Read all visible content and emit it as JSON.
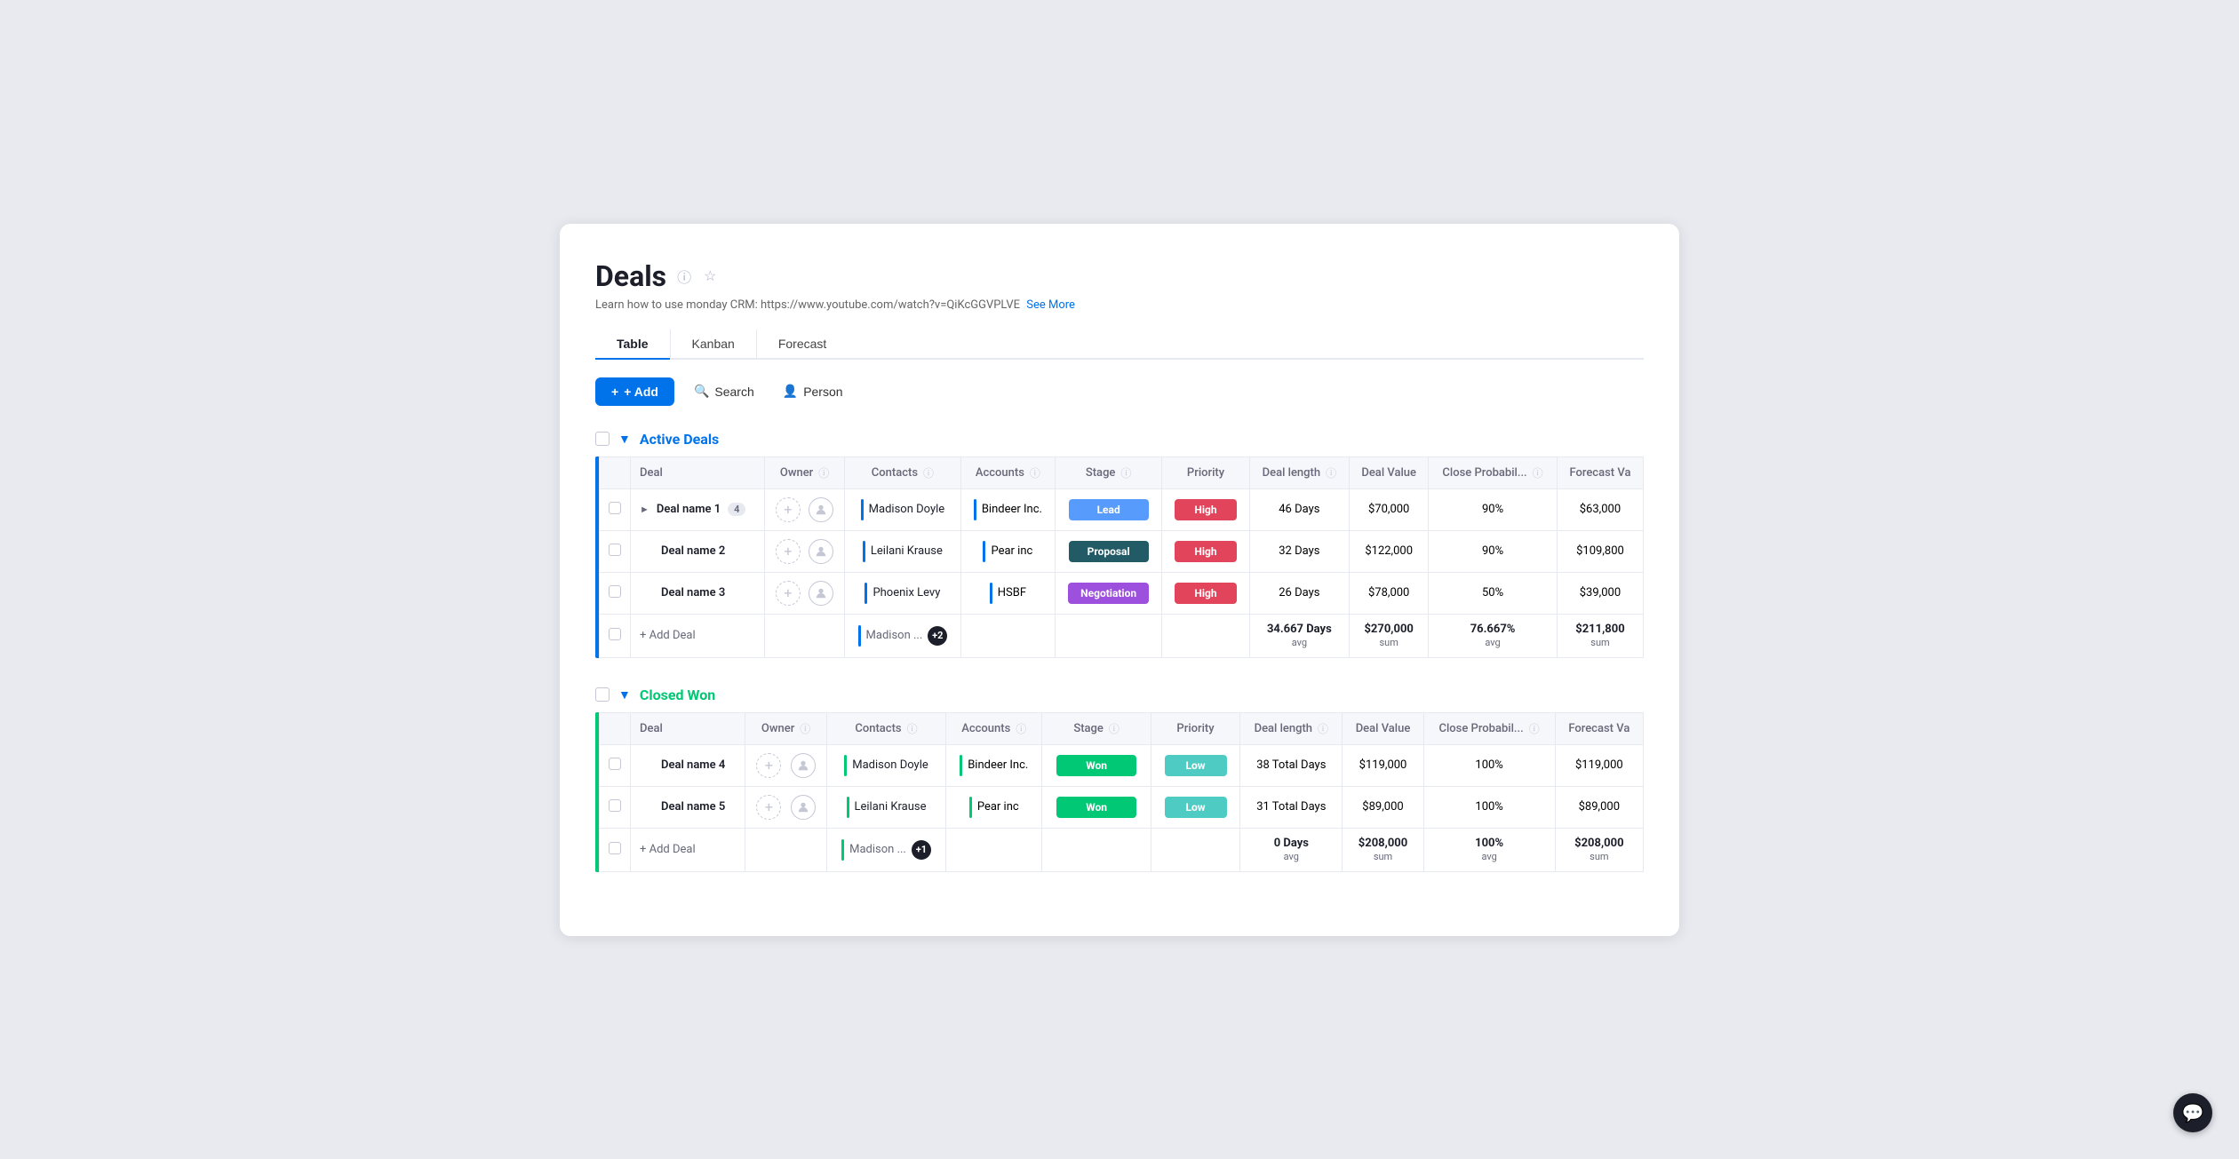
{
  "page": {
    "title": "Deals",
    "learn_text": "Learn how to use monday CRM: https://www.youtube.com/watch?v=QiKcGGVPLVE",
    "learn_link": "See More"
  },
  "tabs": [
    {
      "id": "table",
      "label": "Table",
      "active": true
    },
    {
      "id": "kanban",
      "label": "Kanban",
      "active": false
    },
    {
      "id": "forecast",
      "label": "Forecast",
      "active": false
    }
  ],
  "toolbar": {
    "add_label": "+ Add",
    "search_label": "Search",
    "person_label": "Person"
  },
  "active_deals": {
    "title": "Active Deals",
    "columns": [
      "Deal",
      "Owner",
      "Contacts",
      "Accounts",
      "Stage",
      "Priority",
      "Deal length",
      "Deal Value",
      "Close Probabil...",
      "Forecast Va"
    ],
    "rows": [
      {
        "deal": "Deal name 1",
        "sub_count": 4,
        "has_expand": true,
        "contacts": "Madison Doyle",
        "accounts": "Bindeer Inc.",
        "stage": "Lead",
        "stage_class": "stage-lead",
        "priority": "High",
        "priority_class": "priority-high",
        "deal_length": "46 Days",
        "deal_value": "$70,000",
        "close_prob": "90%",
        "forecast_val": "$63,000"
      },
      {
        "deal": "Deal name 2",
        "has_expand": false,
        "contacts": "Leilani Krause",
        "accounts": "Pear inc",
        "stage": "Proposal",
        "stage_class": "stage-proposal",
        "priority": "High",
        "priority_class": "priority-high",
        "deal_length": "32 Days",
        "deal_value": "$122,000",
        "close_prob": "90%",
        "forecast_val": "$109,800"
      },
      {
        "deal": "Deal name 3",
        "has_expand": false,
        "contacts": "Phoenix Levy",
        "accounts": "HSBF",
        "stage": "Negotiation",
        "stage_class": "stage-negotiation",
        "priority": "High",
        "priority_class": "priority-high",
        "deal_length": "26 Days",
        "deal_value": "$78,000",
        "close_prob": "50%",
        "forecast_val": "$39,000"
      }
    ],
    "add_deal_label": "+ Add Deal",
    "add_deal_contacts": "Madison ...",
    "add_deal_extra": "+2",
    "summary": {
      "deal_length_val": "34.667 Days",
      "deal_length_label": "avg",
      "deal_value_val": "$270,000",
      "deal_value_label": "sum",
      "close_prob_val": "76.667%",
      "close_prob_label": "avg",
      "forecast_val": "$211,800",
      "forecast_label": "sum"
    }
  },
  "closed_won": {
    "title": "Closed Won",
    "columns": [
      "Deal",
      "Owner",
      "Contacts",
      "Accounts",
      "Stage",
      "Priority",
      "Deal length",
      "Deal Value",
      "Close Probabil...",
      "Forecast Va"
    ],
    "rows": [
      {
        "deal": "Deal name 4",
        "has_expand": false,
        "contacts": "Madison Doyle",
        "accounts": "Bindeer Inc.",
        "stage": "Won",
        "stage_class": "stage-won",
        "priority": "Low",
        "priority_class": "priority-low",
        "deal_length": "38 Total Days",
        "deal_value": "$119,000",
        "close_prob": "100%",
        "forecast_val": "$119,000"
      },
      {
        "deal": "Deal name 5",
        "has_expand": false,
        "contacts": "Leilani Krause",
        "accounts": "Pear inc",
        "stage": "Won",
        "stage_class": "stage-won",
        "priority": "Low",
        "priority_class": "priority-low",
        "deal_length": "31 Total Days",
        "deal_value": "$89,000",
        "close_prob": "100%",
        "forecast_val": "$89,000"
      }
    ],
    "add_deal_label": "+ Add Deal",
    "add_deal_contacts": "Madison ...",
    "add_deal_extra": "+1",
    "summary": {
      "deal_length_val": "0 Days",
      "deal_length_label": "avg",
      "deal_value_val": "$208,000",
      "deal_value_label": "sum",
      "close_prob_val": "100%",
      "close_prob_label": "avg",
      "forecast_val": "$208,000",
      "forecast_label": "sum"
    }
  }
}
